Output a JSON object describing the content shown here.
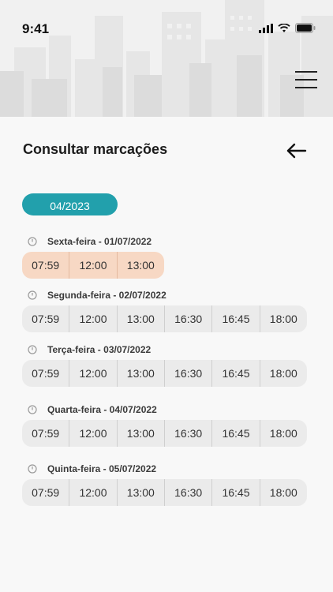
{
  "status_bar": {
    "time": "9:41"
  },
  "page": {
    "title": "Consultar marcações",
    "month_label": "04/2023"
  },
  "days": [
    {
      "label": "Sexta-feira - 01/07/2022",
      "times": [
        "07:59",
        "12:00",
        "13:00"
      ],
      "highlighted": true
    },
    {
      "label": "Segunda-feira - 02/07/2022",
      "times": [
        "07:59",
        "12:00",
        "13:00",
        "16:30",
        "16:45",
        "18:00"
      ],
      "highlighted": false
    },
    {
      "label": "Terça-feira - 03/07/2022",
      "times": [
        "07:59",
        "12:00",
        "13:00",
        "16:30",
        "16:45",
        "18:00"
      ],
      "highlighted": false
    },
    {
      "label": "Quarta-feira - 04/07/2022",
      "times": [
        "07:59",
        "12:00",
        "13:00",
        "16:30",
        "16:45",
        "18:00"
      ],
      "highlighted": false
    },
    {
      "label": "Quinta-feira - 05/07/2022",
      "times": [
        "07:59",
        "12:00",
        "13:00",
        "16:30",
        "16:45",
        "18:00"
      ],
      "highlighted": false
    }
  ],
  "colors": {
    "accent": "#22a0ac",
    "highlight": "#f7d8c4",
    "row_background": "#ebebeb"
  },
  "icons": {
    "menu": "hamburger-menu-icon",
    "back": "arrow-left-icon",
    "day": "clock-icon"
  }
}
